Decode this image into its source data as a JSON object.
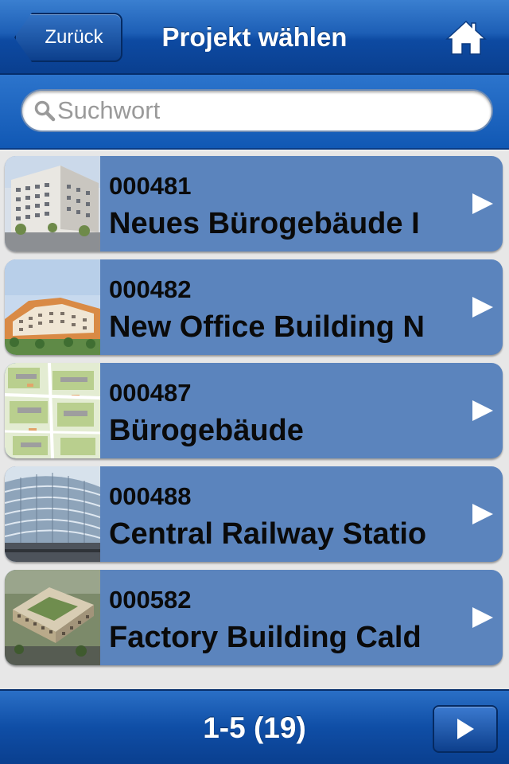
{
  "header": {
    "back_label": "Zurück",
    "title": "Projekt wählen",
    "home_icon": "home-icon"
  },
  "search": {
    "placeholder": "Suchwort",
    "value": "",
    "icon": "search-icon"
  },
  "projects": [
    {
      "number": "000481",
      "name": "Neues Bürogebäude I"
    },
    {
      "number": "000482",
      "name": "New Office Building N"
    },
    {
      "number": "000487",
      "name": "Bürogebäude"
    },
    {
      "number": "000488",
      "name": "Central Railway Statio"
    },
    {
      "number": "000582",
      "name": "Factory Building Cald"
    }
  ],
  "footer": {
    "page_label": "1-5 (19)",
    "next_icon": "play-next-icon"
  },
  "colors": {
    "nav_blue": "#1d5fb6",
    "row_blue": "#5b84bd",
    "list_bg": "#e7e7e7"
  }
}
